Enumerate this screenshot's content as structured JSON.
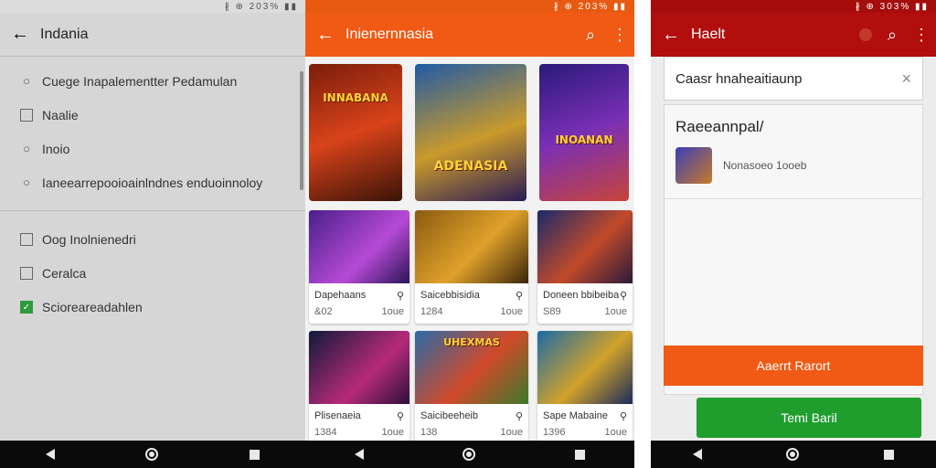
{
  "status": {
    "screen1": {
      "left": "",
      "right": "∦ ⊕ 203% ▮▮"
    },
    "screen2": {
      "left": "",
      "right": "∦ ⊕ 203% ▮▮"
    },
    "screen3": {
      "left": "",
      "right": "∦ ⊕ 303% ▮▮"
    }
  },
  "screen1": {
    "title": "Indania",
    "items_top": [
      {
        "label": "Cuege Inapalementter Pedamulan",
        "icon": "circle-icon"
      },
      {
        "label": "Naalie",
        "icon": "checkbox-icon"
      },
      {
        "label": "Inoio",
        "icon": "circle-icon"
      },
      {
        "label": "Ianeearrepooioainlndnes enduoinnoloy",
        "icon": "circle-icon"
      }
    ],
    "items_bottom": [
      {
        "label": "Oog Inolnienedri",
        "icon": "checkbox-icon"
      },
      {
        "label": "Ceralca",
        "icon": "checkbox-icon"
      },
      {
        "label": "Scioreareadahlen",
        "icon": "checkbox-checked-icon"
      }
    ]
  },
  "screen2": {
    "title": "Inienernnasia",
    "heroes": [
      {
        "label": "INNABANA"
      },
      {
        "label": "ADENASIA"
      },
      {
        "label": "INOANAN"
      }
    ],
    "tiles": [
      {
        "name": "Dapehaans",
        "sub": "&02",
        "tag": "1oue"
      },
      {
        "name": "Saicebbisidia",
        "sub": "1284",
        "tag": "1oue"
      },
      {
        "name": "Doneen bbibeiba",
        "sub": "S89",
        "tag": "1oue"
      },
      {
        "name": "Plisenaeia",
        "sub": "1384",
        "tag": "1oue"
      },
      {
        "name": "Saicibeeheib",
        "sub": "138",
        "tag": "1oue"
      },
      {
        "name": "Sape Mabaine",
        "sub": "1396",
        "tag": "1oue"
      }
    ],
    "tile_art": [
      "INNABANA",
      "ADENASIA",
      "INOANAN",
      "",
      "",
      "",
      "",
      "UHEXMAS",
      ""
    ],
    "colors": {
      "accent": "#f05a14"
    }
  },
  "screen3": {
    "title": "Haelt",
    "search_value": "Caasr hnaheaitiaunp",
    "card_heading": "Raeeannpal/",
    "card_item": "Nonasoeo 1ooeb",
    "orange_button": "Aaerrt Rarort",
    "green_button": "Temi Baril",
    "colors": {
      "header": "#b20e0e",
      "orange": "#f05a14",
      "green": "#1f9e2e"
    }
  }
}
